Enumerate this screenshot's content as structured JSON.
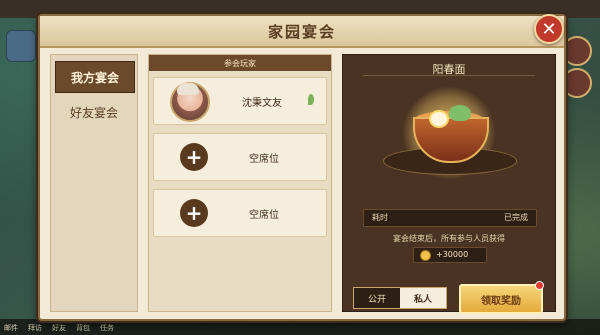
{
  "dialog": {
    "title": "家园宴会",
    "close_label": "✕"
  },
  "tabs": [
    {
      "label": "我方宴会",
      "active": true
    },
    {
      "label": "好友宴会",
      "active": false
    }
  ],
  "participants": {
    "header": "参会玩家",
    "player": {
      "name": "沈秉文友"
    },
    "empty_slots": [
      {
        "label": "空席位"
      },
      {
        "label": "空席位"
      }
    ],
    "plus_label": "+"
  },
  "dish": {
    "name": "阳春面",
    "info_key": "耗时",
    "info_value": "已完成",
    "reward_text": "宴会结束后，所有参与人员获得",
    "reward_amount": "+30000"
  },
  "controls": {
    "public_label": "公开",
    "private_label": "私人",
    "claim_label": "领取奖励"
  },
  "background": {
    "bottom_items": [
      "邮件",
      "拜访",
      "好友",
      "背包",
      "任务"
    ]
  }
}
